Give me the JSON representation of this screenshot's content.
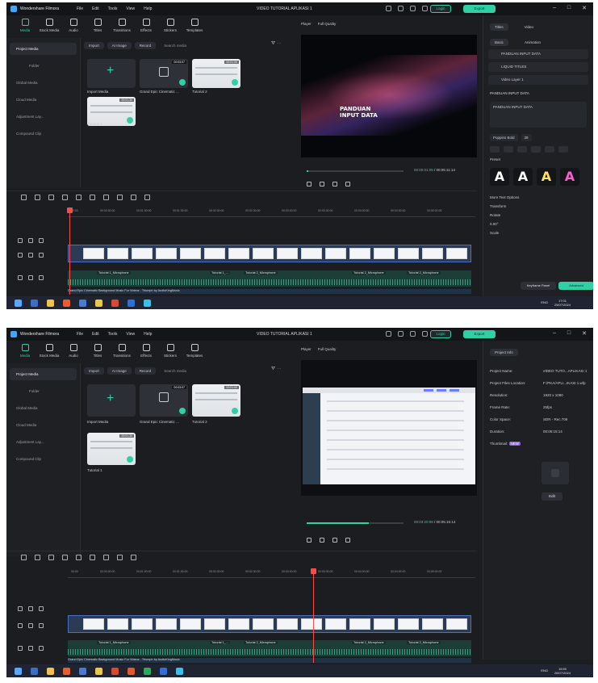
{
  "app": {
    "name": "Wondershare Filmora",
    "menus": [
      "File",
      "Edit",
      "Tools",
      "View",
      "Help"
    ],
    "document_title": "VIDEO TUTORIAL APLIKASI 1",
    "login_label": "Login",
    "export_label": "Export",
    "window_controls": [
      "–",
      "□",
      "✕"
    ]
  },
  "toolbar": [
    "Media",
    "Stock Media",
    "Audio",
    "Titles",
    "Transitions",
    "Effects",
    "Stickers",
    "Templates"
  ],
  "sidebar": [
    "Project Media",
    "Folder",
    "Global Media",
    "Cloud Media",
    "Adjustment Lay...",
    "Compound Clip"
  ],
  "media_bar": {
    "import": "Import",
    "ai_image": "AI Image",
    "record": "Record",
    "search_placeholder": "Search media"
  },
  "media_items": [
    {
      "name": "Import Media"
    },
    {
      "name": "Grand Epic Cinematic ...",
      "duration": "00:03:07"
    },
    {
      "name": "Tutorial 2",
      "duration": "00:01:00"
    },
    {
      "name": "Tutorial 1",
      "duration": "00:01:30"
    }
  ],
  "player": {
    "label": "Player",
    "quality": "Full Quality"
  },
  "screen1": {
    "preview_title_line1": "PANDUAN",
    "preview_title_line2": "INPUT DATA",
    "current_time": "00:00:01:09",
    "total_time": "/ 00:05:11:14",
    "progress": 0.02,
    "panel": {
      "tabs": [
        "Titles",
        "Video"
      ],
      "subtabs": [
        "Basic",
        "Animation"
      ],
      "title_items": [
        "PANDUAN INPUT DATA",
        "LIQUID TITLES",
        "Video Layer 1"
      ],
      "selected_title": "PANDUAN INPUT DATA",
      "text_content": "PANDUAN INPUT DATA",
      "font": "Poppins Bold",
      "font_size": "39",
      "preset_label": "Preset",
      "more_text_options": "More Text Options",
      "transform": "Transform",
      "rotate": "Rotate",
      "rotate_value": "0.00°",
      "scale": "Scale",
      "keyframe_panel": "Keyframe Panel",
      "advanced": "Advanced",
      "preset_glyph": "A"
    },
    "clock_time": "17:01",
    "clock_date": "25/07/2024"
  },
  "screen2": {
    "current_time": "00:03:20:08",
    "total_time": "/ 00:05:15:14",
    "progress": 0.64,
    "panel": {
      "tab": "Project Info",
      "rows": [
        {
          "key": "Project Name:",
          "value": "VIDEO TUTO...APLIKASI 1"
        },
        {
          "key": "Project Files Location:",
          "value": "F:/PKA/APLI...IKASI 1.wfp"
        },
        {
          "key": "Resolution:",
          "value": "1920 x 1080"
        },
        {
          "key": "Frame Rate:",
          "value": "25fps"
        },
        {
          "key": "Color Space:",
          "value": "SDR - Rec.709"
        },
        {
          "key": "Duration:",
          "value": "00:05:15:14"
        }
      ],
      "thumbnail_label": "Thumbnail:",
      "new_badge": "NEW",
      "edit_label": "Edit"
    },
    "clock_time": "15:50",
    "clock_date": "26/07/2024"
  },
  "timeline": {
    "ruler_ticks": [
      "00:00",
      "00:00:30:00",
      "00:01:00:00",
      "00:01:30:00",
      "00:02:00:00",
      "00:02:30:00",
      "00:03:00:00",
      "00:03:30:00",
      "00:04:00:00",
      "00:04:30:00",
      "00:05:00:00"
    ],
    "audio_labels": [
      "Tutorial 1_Microphone",
      "Tutorial 1_...",
      "Tutorial 2_Microphone",
      "Tutorial 2_Microphone",
      "Tutorial 2_Microphone"
    ],
    "music_label": "Grand Epic Cinematic Background Music For Videos - Triumph by AudioKingMusic",
    "lang": "ENG"
  },
  "colors": {
    "accent": "#2fd0a6",
    "background": "#1b1d21",
    "panel": "#1e2024",
    "playhead": "#ff4a4a"
  }
}
